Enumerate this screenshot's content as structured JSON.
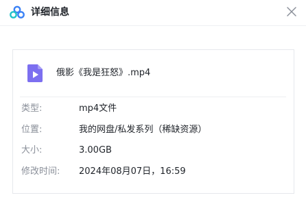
{
  "dialog": {
    "title": "详细信息",
    "icons": {
      "logo": "cloud-logo-icon",
      "close": "close-icon",
      "file": "video-file-icon"
    },
    "colors": {
      "logo_blue": "#3b82f6",
      "logo_teal": "#22c3c9",
      "video_icon": "#7c6ff0"
    }
  },
  "file": {
    "name": "俄影《我是狂怒》.mp4"
  },
  "details": [
    {
      "label": "类型:",
      "value": "mp4文件"
    },
    {
      "label": "位置:",
      "value": "我的网盘/私发系列（稀缺资源）"
    },
    {
      "label": "大小:",
      "value": "3.00GB"
    },
    {
      "label": "修改时间:",
      "value": "2024年08月07日，16:59"
    }
  ]
}
